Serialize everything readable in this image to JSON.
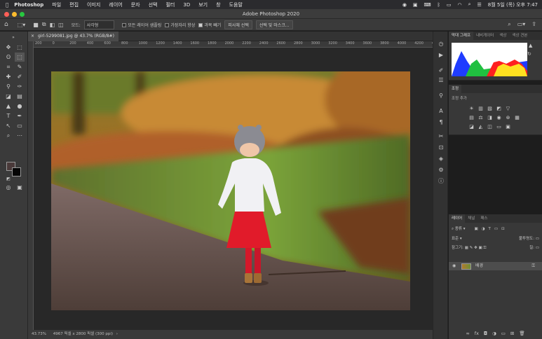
{
  "menubar": {
    "apple": "",
    "app_name": "Photoshop",
    "items": [
      "파일",
      "편집",
      "이미지",
      "레이어",
      "문자",
      "선택",
      "필터",
      "3D",
      "보기",
      "창",
      "도움말"
    ],
    "clock": "8월 5일 (목) 오후 7:47"
  },
  "window": {
    "title": "Adobe Photoshop 2020"
  },
  "options_bar": {
    "mode_label": "모드:",
    "mode_value": "사각형",
    "all_layers_label": "모든 레이어 샘플링",
    "enhance_edge_label": "가장자리 향상",
    "erase_label": "과목 빼기",
    "subject_button": "피사체 선택",
    "mask_button": "선택 및 마스크..."
  },
  "document": {
    "tab_label": "girl-5299081.jpg @ 43.7% (RGB/8#)",
    "close_glyph": "×",
    "zoom": "43.73%",
    "dimensions": "4967 픽셀 x 2800 픽셀 (300 ppi)"
  },
  "ruler": {
    "h_ticks": [
      "200",
      "0",
      "200",
      "400",
      "600",
      "800",
      "1000",
      "1200",
      "1400",
      "1600",
      "1800",
      "2000",
      "2200",
      "2400",
      "2600",
      "2800",
      "3000",
      "3200",
      "3400",
      "3600",
      "3800",
      "4000",
      "4200",
      "4400"
    ]
  },
  "panels": {
    "histogram_tabs": [
      "막대 그래프",
      "내비게이터",
      "색상",
      "색상 견본"
    ],
    "adjustments_tab": "조정",
    "adjustments_hint": "조정 추가",
    "layers_tabs": [
      "레이어",
      "채널",
      "패스"
    ],
    "kind_label": "종류",
    "blend_mode": "표준",
    "opacity_label": "불투명도:",
    "fill_label": "칠:",
    "lock_label": "잠그기:",
    "background_layer": "배경"
  },
  "colors": {
    "app_bg": "#1d1d1d",
    "panel_bg": "#383838",
    "red": "#e11b2a"
  }
}
